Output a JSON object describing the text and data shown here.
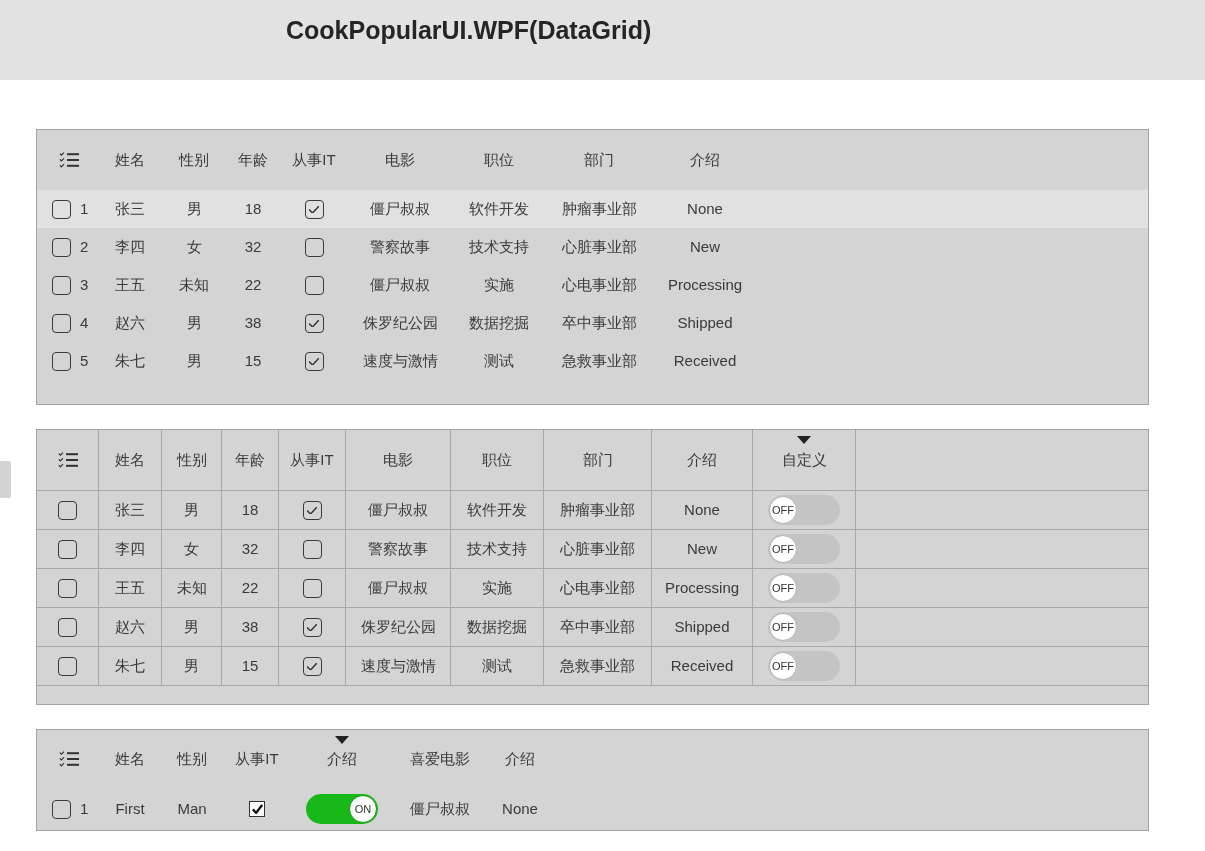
{
  "title": "CookPopularUI.WPF(DataGrid)",
  "grids": [
    {
      "lines": false,
      "columns": [
        {
          "label": "姓名",
          "sorted": false
        },
        {
          "label": "性别",
          "sorted": false
        },
        {
          "label": "年龄",
          "sorted": false
        },
        {
          "label": "从事IT",
          "sorted": false
        },
        {
          "label": "电影",
          "sorted": false
        },
        {
          "label": "职位",
          "sorted": false
        },
        {
          "label": "部门",
          "sorted": false
        },
        {
          "label": "介绍",
          "sorted": false
        }
      ],
      "rows": [
        {
          "checked": false,
          "number": "1",
          "highlighted": true,
          "cells": [
            {
              "kind": "text",
              "text": "张三"
            },
            {
              "kind": "text",
              "text": "男"
            },
            {
              "kind": "text",
              "text": "18"
            },
            {
              "kind": "check",
              "checked": true
            },
            {
              "kind": "text",
              "text": "僵尸叔叔"
            },
            {
              "kind": "text",
              "text": "软件开发"
            },
            {
              "kind": "text",
              "text": "肿瘤事业部"
            },
            {
              "kind": "text",
              "text": "None"
            }
          ]
        },
        {
          "checked": false,
          "number": "2",
          "highlighted": false,
          "cells": [
            {
              "kind": "text",
              "text": "李四"
            },
            {
              "kind": "text",
              "text": "女"
            },
            {
              "kind": "text",
              "text": "32"
            },
            {
              "kind": "check",
              "checked": false
            },
            {
              "kind": "text",
              "text": "警察故事"
            },
            {
              "kind": "text",
              "text": "技术支持"
            },
            {
              "kind": "text",
              "text": "心脏事业部"
            },
            {
              "kind": "text",
              "text": "New"
            }
          ]
        },
        {
          "checked": false,
          "number": "3",
          "highlighted": false,
          "cells": [
            {
              "kind": "text",
              "text": "王五"
            },
            {
              "kind": "text",
              "text": "未知"
            },
            {
              "kind": "text",
              "text": "22"
            },
            {
              "kind": "check",
              "checked": false
            },
            {
              "kind": "text",
              "text": "僵尸叔叔"
            },
            {
              "kind": "text",
              "text": "实施"
            },
            {
              "kind": "text",
              "text": "心电事业部"
            },
            {
              "kind": "text",
              "text": "Processing"
            }
          ]
        },
        {
          "checked": false,
          "number": "4",
          "highlighted": false,
          "cells": [
            {
              "kind": "text",
              "text": "赵六"
            },
            {
              "kind": "text",
              "text": "男"
            },
            {
              "kind": "text",
              "text": "38"
            },
            {
              "kind": "check",
              "checked": true
            },
            {
              "kind": "text",
              "text": "侏罗纪公园"
            },
            {
              "kind": "text",
              "text": "数据挖掘"
            },
            {
              "kind": "text",
              "text": "卒中事业部"
            },
            {
              "kind": "text",
              "text": "Shipped"
            }
          ]
        },
        {
          "checked": false,
          "number": "5",
          "highlighted": false,
          "cells": [
            {
              "kind": "text",
              "text": "朱七"
            },
            {
              "kind": "text",
              "text": "男"
            },
            {
              "kind": "text",
              "text": "15"
            },
            {
              "kind": "check",
              "checked": true
            },
            {
              "kind": "text",
              "text": "速度与激情"
            },
            {
              "kind": "text",
              "text": "测试"
            },
            {
              "kind": "text",
              "text": "急救事业部"
            },
            {
              "kind": "text",
              "text": "Received"
            }
          ]
        }
      ]
    },
    {
      "lines": true,
      "columns": [
        {
          "label": "姓名",
          "sorted": false
        },
        {
          "label": "性别",
          "sorted": false
        },
        {
          "label": "年龄",
          "sorted": false
        },
        {
          "label": "从事IT",
          "sorted": false
        },
        {
          "label": "电影",
          "sorted": false
        },
        {
          "label": "职位",
          "sorted": false
        },
        {
          "label": "部门",
          "sorted": false
        },
        {
          "label": "介绍",
          "sorted": false
        },
        {
          "label": "自定义",
          "sorted": true
        }
      ],
      "rows": [
        {
          "checked": false,
          "cells": [
            {
              "kind": "text",
              "text": "张三"
            },
            {
              "kind": "text",
              "text": "男"
            },
            {
              "kind": "text",
              "text": "18"
            },
            {
              "kind": "check",
              "checked": true
            },
            {
              "kind": "text",
              "text": "僵尸叔叔"
            },
            {
              "kind": "text",
              "text": "软件开发"
            },
            {
              "kind": "text",
              "text": "肿瘤事业部"
            },
            {
              "kind": "text",
              "text": "None"
            },
            {
              "kind": "toggle",
              "on": false,
              "label": "OFF"
            }
          ]
        },
        {
          "checked": false,
          "cells": [
            {
              "kind": "text",
              "text": "李四"
            },
            {
              "kind": "text",
              "text": "女"
            },
            {
              "kind": "text",
              "text": "32"
            },
            {
              "kind": "check",
              "checked": false
            },
            {
              "kind": "text",
              "text": "警察故事"
            },
            {
              "kind": "text",
              "text": "技术支持"
            },
            {
              "kind": "text",
              "text": "心脏事业部"
            },
            {
              "kind": "text",
              "text": "New"
            },
            {
              "kind": "toggle",
              "on": false,
              "label": "OFF"
            }
          ]
        },
        {
          "checked": false,
          "cells": [
            {
              "kind": "text",
              "text": "王五"
            },
            {
              "kind": "text",
              "text": "未知"
            },
            {
              "kind": "text",
              "text": "22"
            },
            {
              "kind": "check",
              "checked": false
            },
            {
              "kind": "text",
              "text": "僵尸叔叔"
            },
            {
              "kind": "text",
              "text": "实施"
            },
            {
              "kind": "text",
              "text": "心电事业部"
            },
            {
              "kind": "text",
              "text": "Processing"
            },
            {
              "kind": "toggle",
              "on": false,
              "label": "OFF"
            }
          ]
        },
        {
          "checked": false,
          "cells": [
            {
              "kind": "text",
              "text": "赵六"
            },
            {
              "kind": "text",
              "text": "男"
            },
            {
              "kind": "text",
              "text": "38"
            },
            {
              "kind": "check",
              "checked": true
            },
            {
              "kind": "text",
              "text": "侏罗纪公园"
            },
            {
              "kind": "text",
              "text": "数据挖掘"
            },
            {
              "kind": "text",
              "text": "卒中事业部"
            },
            {
              "kind": "text",
              "text": "Shipped"
            },
            {
              "kind": "toggle",
              "on": false,
              "label": "OFF"
            }
          ]
        },
        {
          "checked": false,
          "cells": [
            {
              "kind": "text",
              "text": "朱七"
            },
            {
              "kind": "text",
              "text": "男"
            },
            {
              "kind": "text",
              "text": "15"
            },
            {
              "kind": "check",
              "checked": true
            },
            {
              "kind": "text",
              "text": "速度与激情"
            },
            {
              "kind": "text",
              "text": "测试"
            },
            {
              "kind": "text",
              "text": "急救事业部"
            },
            {
              "kind": "text",
              "text": "Received"
            },
            {
              "kind": "toggle",
              "on": false,
              "label": "OFF"
            }
          ]
        }
      ]
    },
    {
      "lines": false,
      "columns": [
        {
          "label": "姓名",
          "sorted": false
        },
        {
          "label": "性别",
          "sorted": false
        },
        {
          "label": "从事IT",
          "sorted": false
        },
        {
          "label": "介绍",
          "sorted": true
        },
        {
          "label": "喜爱电影",
          "sorted": false
        },
        {
          "label": "介绍",
          "sorted": false
        }
      ],
      "rows": [
        {
          "checked": false,
          "number": "1",
          "cells": [
            {
              "kind": "text",
              "text": "First"
            },
            {
              "kind": "text",
              "text": "Man"
            },
            {
              "kind": "tick-box",
              "checked": true
            },
            {
              "kind": "toggle",
              "on": true,
              "label": "ON"
            },
            {
              "kind": "text",
              "text": "僵尸叔叔"
            },
            {
              "kind": "text",
              "text": "None"
            }
          ]
        }
      ]
    }
  ]
}
